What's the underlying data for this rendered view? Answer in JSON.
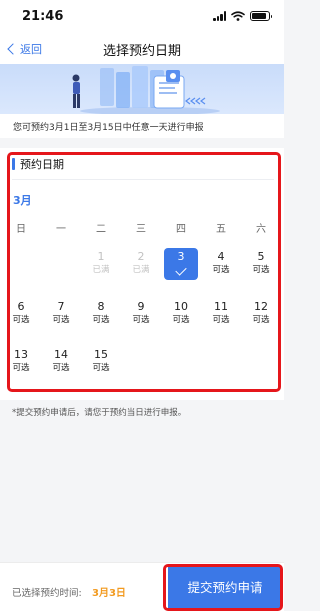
{
  "status_bar": {
    "time": "21:46"
  },
  "nav": {
    "back_label": "返回",
    "title": "选择预约日期"
  },
  "notice": "您可预约3月1日至3月15日中任意一天进行申报",
  "calendar": {
    "section_title": "预约日期",
    "month": "3月",
    "weekdays": [
      "日",
      "一",
      "二",
      "三",
      "四",
      "五",
      "六"
    ],
    "days": [
      {
        "num": "1",
        "status": "已满"
      },
      {
        "num": "2",
        "status": "已满"
      },
      {
        "num": "3",
        "status": ""
      },
      {
        "num": "4",
        "status": "可选"
      },
      {
        "num": "5",
        "status": "可选"
      },
      {
        "num": "6",
        "status": "可选"
      },
      {
        "num": "7",
        "status": "可选"
      },
      {
        "num": "8",
        "status": "可选"
      },
      {
        "num": "9",
        "status": "可选"
      },
      {
        "num": "10",
        "status": "可选"
      },
      {
        "num": "11",
        "status": "可选"
      },
      {
        "num": "12",
        "status": "可选"
      },
      {
        "num": "13",
        "status": "可选"
      },
      {
        "num": "14",
        "status": "可选"
      },
      {
        "num": "15",
        "status": "可选"
      }
    ],
    "selected_day": "3"
  },
  "footnote": "*提交预约申请后，请您于预约当日进行申报。",
  "bottom": {
    "selected_label": "已选择预约时间:",
    "selected_value": "3月3日",
    "submit_label": "提交预约申请"
  },
  "colors": {
    "accent": "#3b78e7",
    "highlight_red": "#e5161b",
    "selected_orange": "#f29a1f"
  }
}
